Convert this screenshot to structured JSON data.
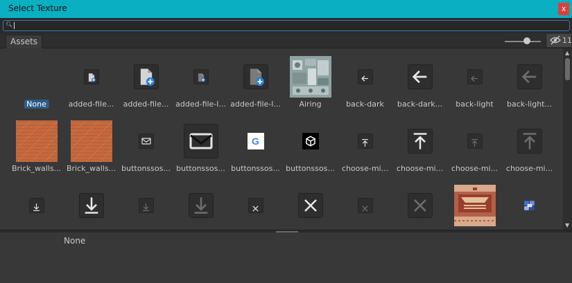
{
  "window": {
    "title": "Select Texture",
    "close_label": "x"
  },
  "search": {
    "value": ""
  },
  "tabs": [
    {
      "label": "Assets"
    }
  ],
  "toolbar": {
    "hidden_count": "11"
  },
  "assets": [
    {
      "label": "None",
      "kind": "none",
      "selected": true
    },
    {
      "label": "added-file...",
      "kind": "doc-plus-sm"
    },
    {
      "label": "added-file...",
      "kind": "doc-plus-lg"
    },
    {
      "label": "added-file-l...",
      "kind": "doc-plus-sm-dim"
    },
    {
      "label": "added-file-l...",
      "kind": "doc-plus-lg-dim"
    },
    {
      "label": "Airing",
      "kind": "texture-airing"
    },
    {
      "label": "back-dark",
      "kind": "arrow-left-sm"
    },
    {
      "label": "back-dark...",
      "kind": "arrow-left-lg"
    },
    {
      "label": "back-light",
      "kind": "arrow-left-sm-dim"
    },
    {
      "label": "back-light...",
      "kind": "arrow-left-lg-dim"
    },
    {
      "label": "Brick_walls...",
      "kind": "texture-brick"
    },
    {
      "label": "Brick_walls...",
      "kind": "texture-brick"
    },
    {
      "label": "buttonssos...",
      "kind": "mail-sm"
    },
    {
      "label": "buttonssos...",
      "kind": "mail-lg"
    },
    {
      "label": "buttonssos...",
      "kind": "google"
    },
    {
      "label": "buttonssos...",
      "kind": "unity"
    },
    {
      "label": "choose-mi...",
      "kind": "upload-sm"
    },
    {
      "label": "choose-mi...",
      "kind": "upload-lg"
    },
    {
      "label": "choose-mi...",
      "kind": "upload-sm-dim"
    },
    {
      "label": "choose-mi...",
      "kind": "upload-lg-dim"
    },
    {
      "label": "",
      "kind": "download-sm"
    },
    {
      "label": "",
      "kind": "download-lg"
    },
    {
      "label": "",
      "kind": "download-sm-dim"
    },
    {
      "label": "",
      "kind": "download-lg-dim"
    },
    {
      "label": "",
      "kind": "x-sm"
    },
    {
      "label": "",
      "kind": "x-lg"
    },
    {
      "label": "",
      "kind": "x-sm-dim"
    },
    {
      "label": "",
      "kind": "x-lg-dim"
    },
    {
      "label": "",
      "kind": "texture-carpet"
    },
    {
      "label": "",
      "kind": "pixel-icon"
    }
  ],
  "preview": {
    "label": "None"
  },
  "colors": {
    "titlebar": "#0aafc2",
    "selection": "#2c5d87",
    "close": "#d9423a"
  }
}
